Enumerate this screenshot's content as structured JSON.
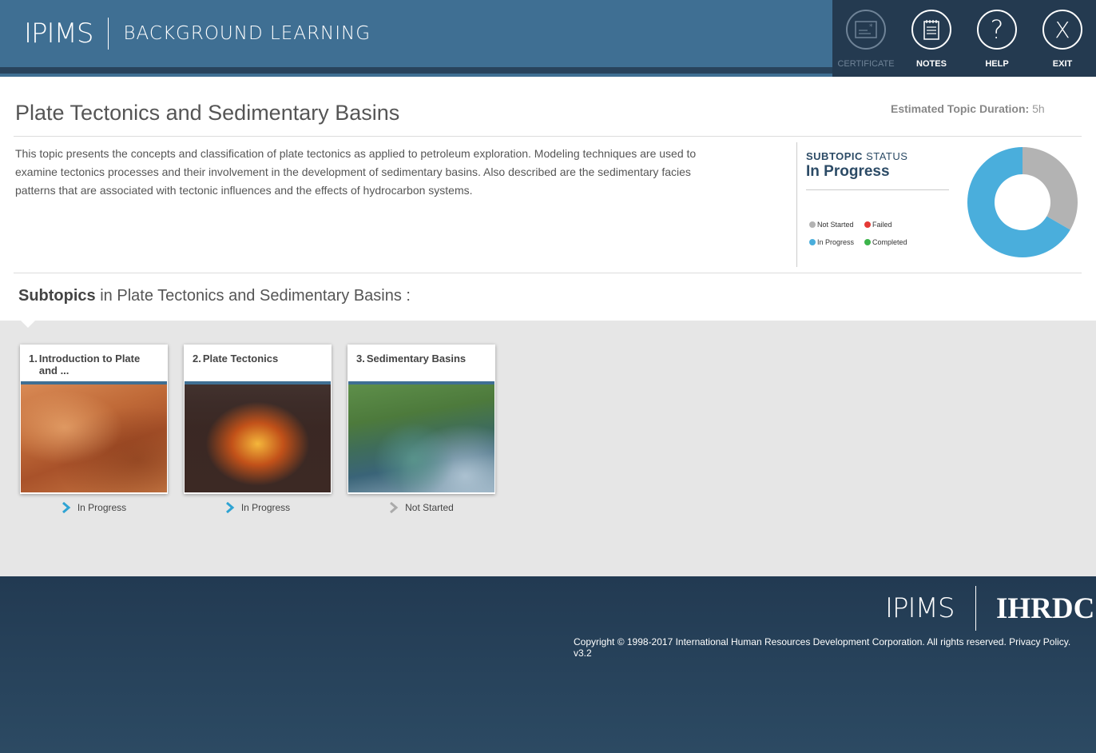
{
  "header": {
    "logo": "IPIMS",
    "section": "BACKGROUND LEARNING",
    "tools": [
      {
        "label": "CERTIFICATE",
        "icon": "certificate-icon",
        "enabled": false
      },
      {
        "label": "NOTES",
        "icon": "notes-icon",
        "enabled": true
      },
      {
        "label": "HELP",
        "icon": "help-icon",
        "enabled": true
      },
      {
        "label": "EXIT",
        "icon": "close-icon",
        "enabled": true
      }
    ]
  },
  "topic": {
    "title": "Plate Tectonics and Sedimentary Basins",
    "duration_label": "Estimated Topic Duration:",
    "duration_value": "5h",
    "description": "This topic presents the concepts and classification of plate tectonics as applied to petroleum exploration. Modeling techniques are used to examine tectonics processes and their involvement in the development of sedimentary basins. Also described are the sedimentary facies patterns that are associated with tectonic influences and the effects of hydrocarbon systems."
  },
  "status": {
    "heading_bold": "SUBTOPIC",
    "heading_rest": "STATUS",
    "value": "In Progress",
    "legend": [
      {
        "label": "Not Started",
        "color": "#b3b3b3"
      },
      {
        "label": "Failed",
        "color": "#e53935"
      },
      {
        "label": "In Progress",
        "color": "#4aaedc"
      },
      {
        "label": "Completed",
        "color": "#3cb44b"
      }
    ],
    "chart": {
      "in_progress": 2,
      "not_started": 1,
      "in_progress_color": "#4aaedc",
      "not_started_color": "#b3b3b3"
    }
  },
  "subtopics": {
    "heading_bold": "Subtopics",
    "heading_rest": "in Plate Tectonics and Sedimentary Basins :",
    "items": [
      {
        "num": "1.",
        "title": "Introduction to Plate and ...",
        "status": "In Progress",
        "status_color": "#2ea3d3"
      },
      {
        "num": "2.",
        "title": "Plate Tectonics",
        "status": "In Progress",
        "status_color": "#2ea3d3"
      },
      {
        "num": "3.",
        "title": "Sedimentary Basins",
        "status": "Not Started",
        "status_color": "#aaaaaa"
      }
    ]
  },
  "footer": {
    "logo_left": "IPIMS",
    "logo_right": "IHRDC",
    "copyright": "Copyright © 1998-2017 International Human Resources Development Corporation. All rights reserved. Privacy Policy. v3.2"
  }
}
